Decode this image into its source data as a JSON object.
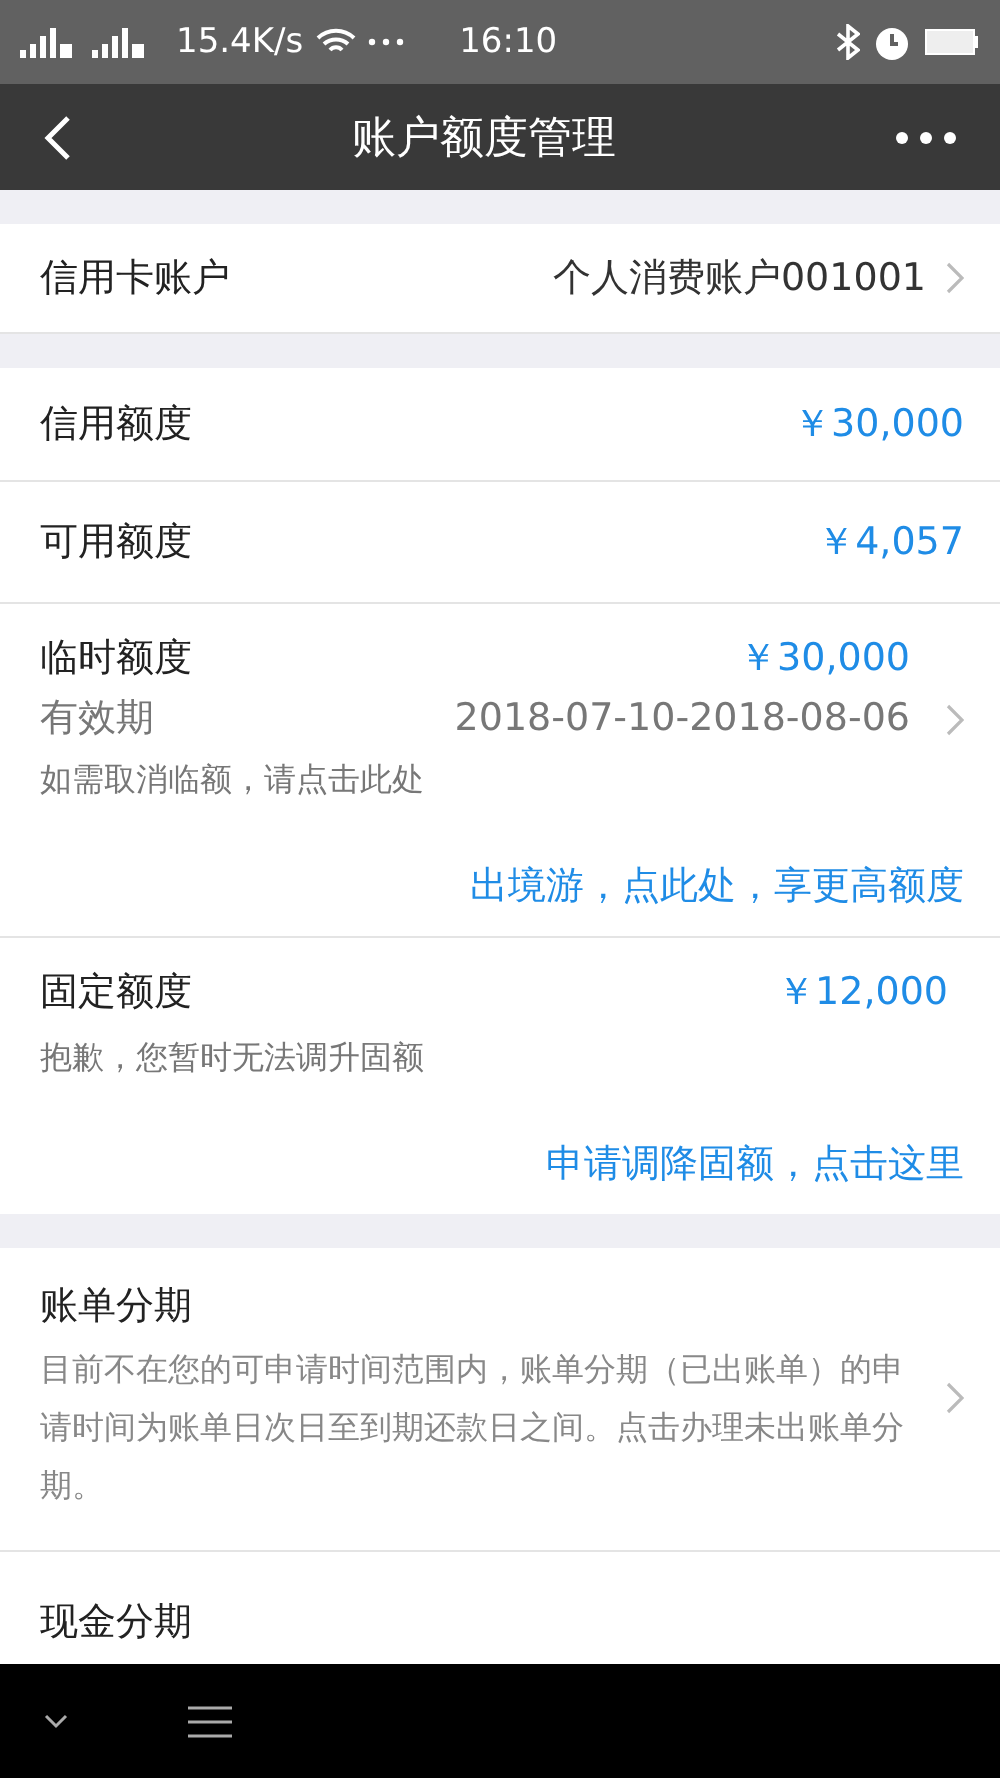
{
  "status_bar": {
    "network_speed": "15.4K/s",
    "time": "16:10"
  },
  "header": {
    "title": "账户额度管理"
  },
  "account": {
    "label": "信用卡账户",
    "value": "个人消费账户001001"
  },
  "credit_limit": {
    "label": "信用额度",
    "amount": "￥30,000"
  },
  "available_limit": {
    "label": "可用额度",
    "amount": "￥4,057"
  },
  "temporary_limit": {
    "label": "临时额度",
    "amount": "￥30,000",
    "validity_label": "有效期",
    "validity": "2018-07-10-2018-08-06",
    "hint": "如需取消临额，请点击此处",
    "link": "出境游，点此处，享更高额度"
  },
  "fixed_limit": {
    "label": "固定额度",
    "amount": "￥12,000",
    "hint": "抱歉，您暂时无法调升固额",
    "link": "申请调降固额，点击这里"
  },
  "installments": [
    {
      "title": "账单分期",
      "description": "目前不在您的可申请时间范围内，账单分期（已出账单）的申请时间为账单日次日至到期还款日之间。点击办理未出账单分期。"
    },
    {
      "title": "现金分期"
    }
  ]
}
